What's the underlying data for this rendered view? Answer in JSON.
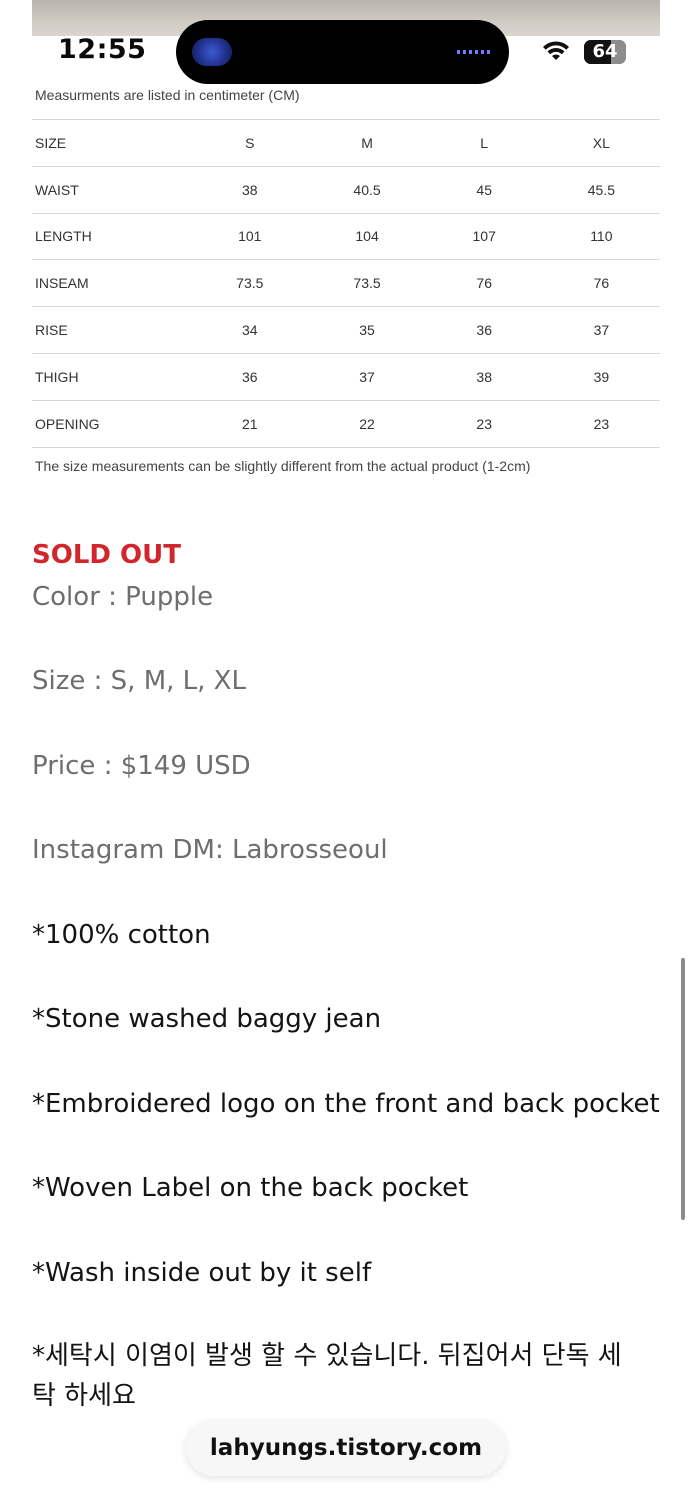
{
  "status_bar": {
    "time": "12:55",
    "battery": "64",
    "icons": [
      "wifi-icon",
      "battery-icon"
    ]
  },
  "size_chart": {
    "note_top": "Measurments are listed in centimeter (CM)",
    "header": [
      "SIZE",
      "S",
      "M",
      "L",
      "XL"
    ],
    "rows": [
      [
        "WAIST",
        "38",
        "40.5",
        "45",
        "45.5"
      ],
      [
        "LENGTH",
        "101",
        "104",
        "107",
        "110"
      ],
      [
        "INSEAM",
        "73.5",
        "73.5",
        "76",
        "76"
      ],
      [
        "RISE",
        "34",
        "35",
        "36",
        "37"
      ],
      [
        "THIGH",
        "36",
        "37",
        "38",
        "39"
      ],
      [
        "OPENING",
        "21",
        "22",
        "23",
        "23"
      ]
    ],
    "note_bottom": "The size measurements can be slightly different from the actual product (1-2cm)"
  },
  "product": {
    "sold_out": "SOLD OUT",
    "color": "Color : Pupple",
    "size": "Size : S, M, L, XL",
    "price": "Price : $149 USD",
    "instagram": "Instagram DM: Labrosseoul",
    "details": [
      "*100% cotton",
      "*Stone washed baggy jean",
      "*Embroidered logo on the front and back pocket",
      "*Woven Label on the back pocket",
      "*Wash inside out by it self",
      "*세탁시 이염이 발생 할 수 있습니다. 뒤집어서 단독 세탁 하세요"
    ]
  },
  "browser": {
    "url": "lahyungs.tistory.com"
  },
  "colors": {
    "sold_out": "#d0262c",
    "gray_text": "#6e6e6e",
    "dark_text": "#141414"
  }
}
